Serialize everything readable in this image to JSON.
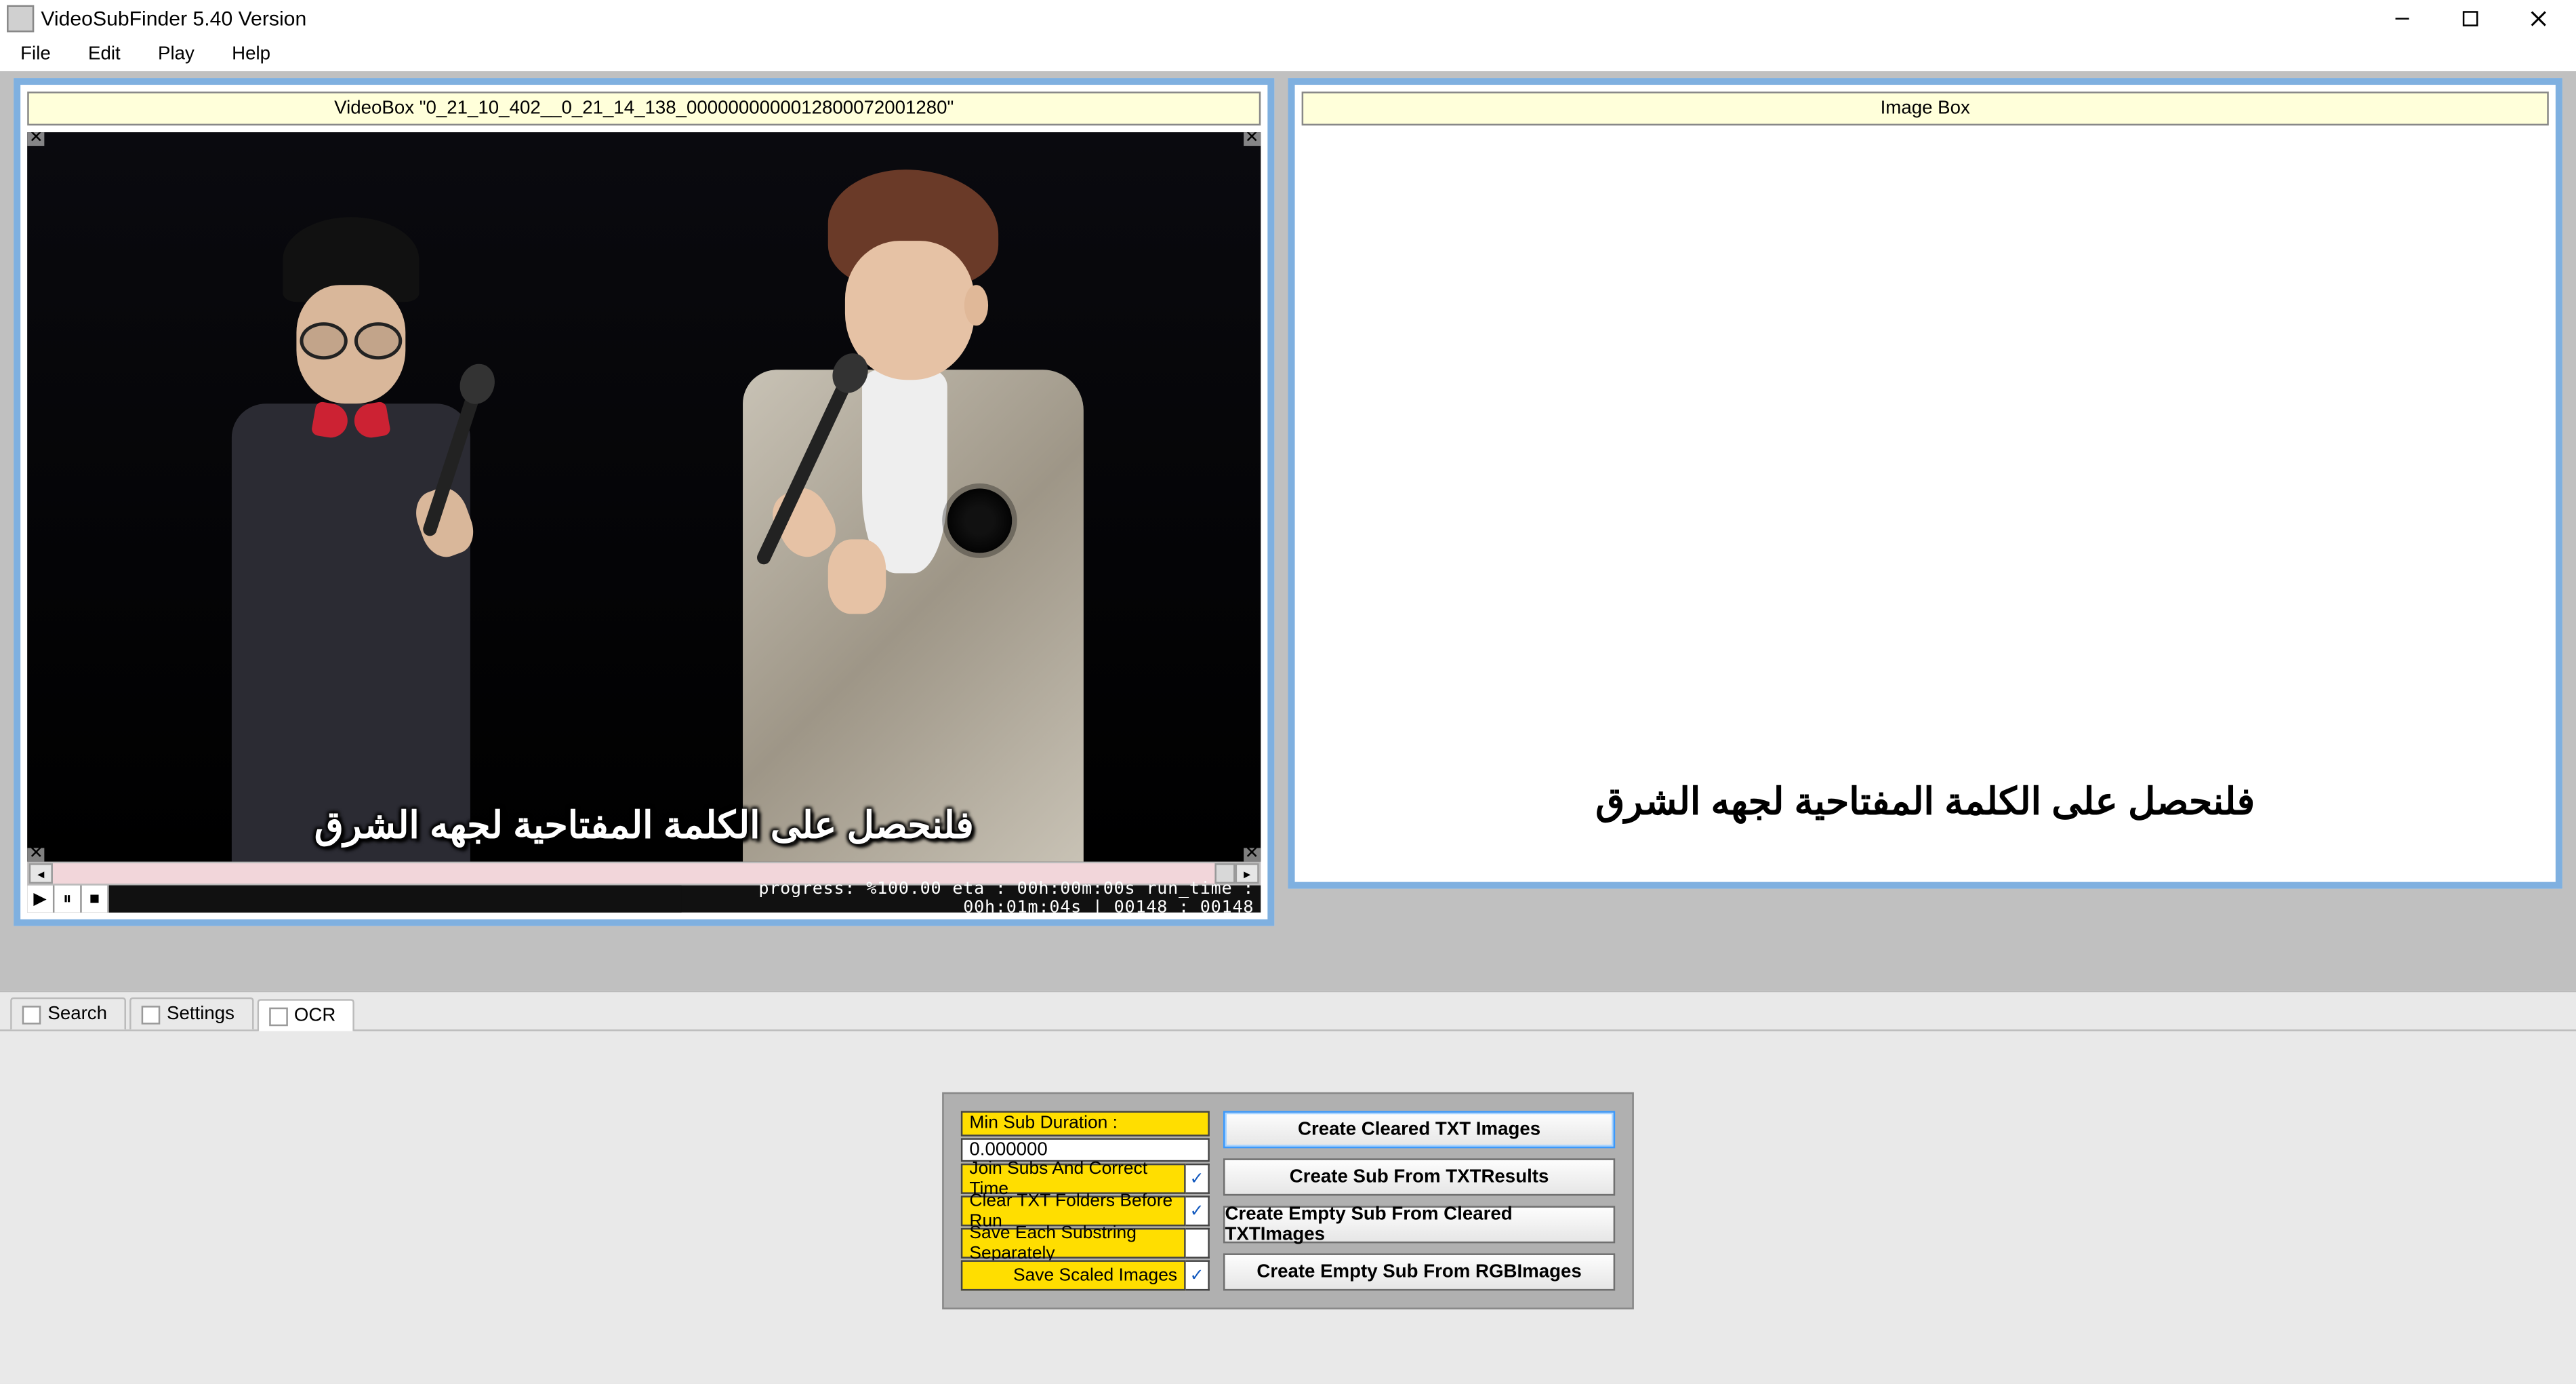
{
  "window": {
    "title": "VideoSubFinder 5.40 Version"
  },
  "menu": {
    "file": "File",
    "edit": "Edit",
    "play": "Play",
    "help": "Help"
  },
  "video_panel": {
    "header": "VideoBox \"0_21_10_402__0_21_14_138_0000000000012800072001280\"",
    "subtitle": "فلنحصل على الكلمة المفتاحية لجهه الشرق",
    "progress_text": "progress: %100.00 eta : 00h:00m:00s run_time : 00h:01m:04s   |   00148 : 00148"
  },
  "image_panel": {
    "header": "Image Box",
    "subtitle": "فلنحصل على الكلمة المفتاحية لجهه الشرق"
  },
  "tabs": {
    "search": "Search",
    "settings": "Settings",
    "ocr": "OCR"
  },
  "ocr": {
    "min_sub_duration_label": "Min Sub Duration :",
    "min_sub_duration_value": "0.000000",
    "join_subs": "Join Subs And Correct Time",
    "clear_txt": "Clear TXT Folders Before Run",
    "save_each": "Save Each Substring Separately",
    "save_scaled": "Save Scaled Images",
    "join_subs_checked": true,
    "clear_txt_checked": true,
    "save_each_checked": false,
    "save_scaled_checked": true,
    "btn_cleared": "Create Cleared TXT Images",
    "btn_sub_txt": "Create Sub From TXTResults",
    "btn_empty_cleared": "Create Empty Sub From Cleared TXTImages",
    "btn_empty_rgb": "Create Empty Sub From RGBImages"
  }
}
